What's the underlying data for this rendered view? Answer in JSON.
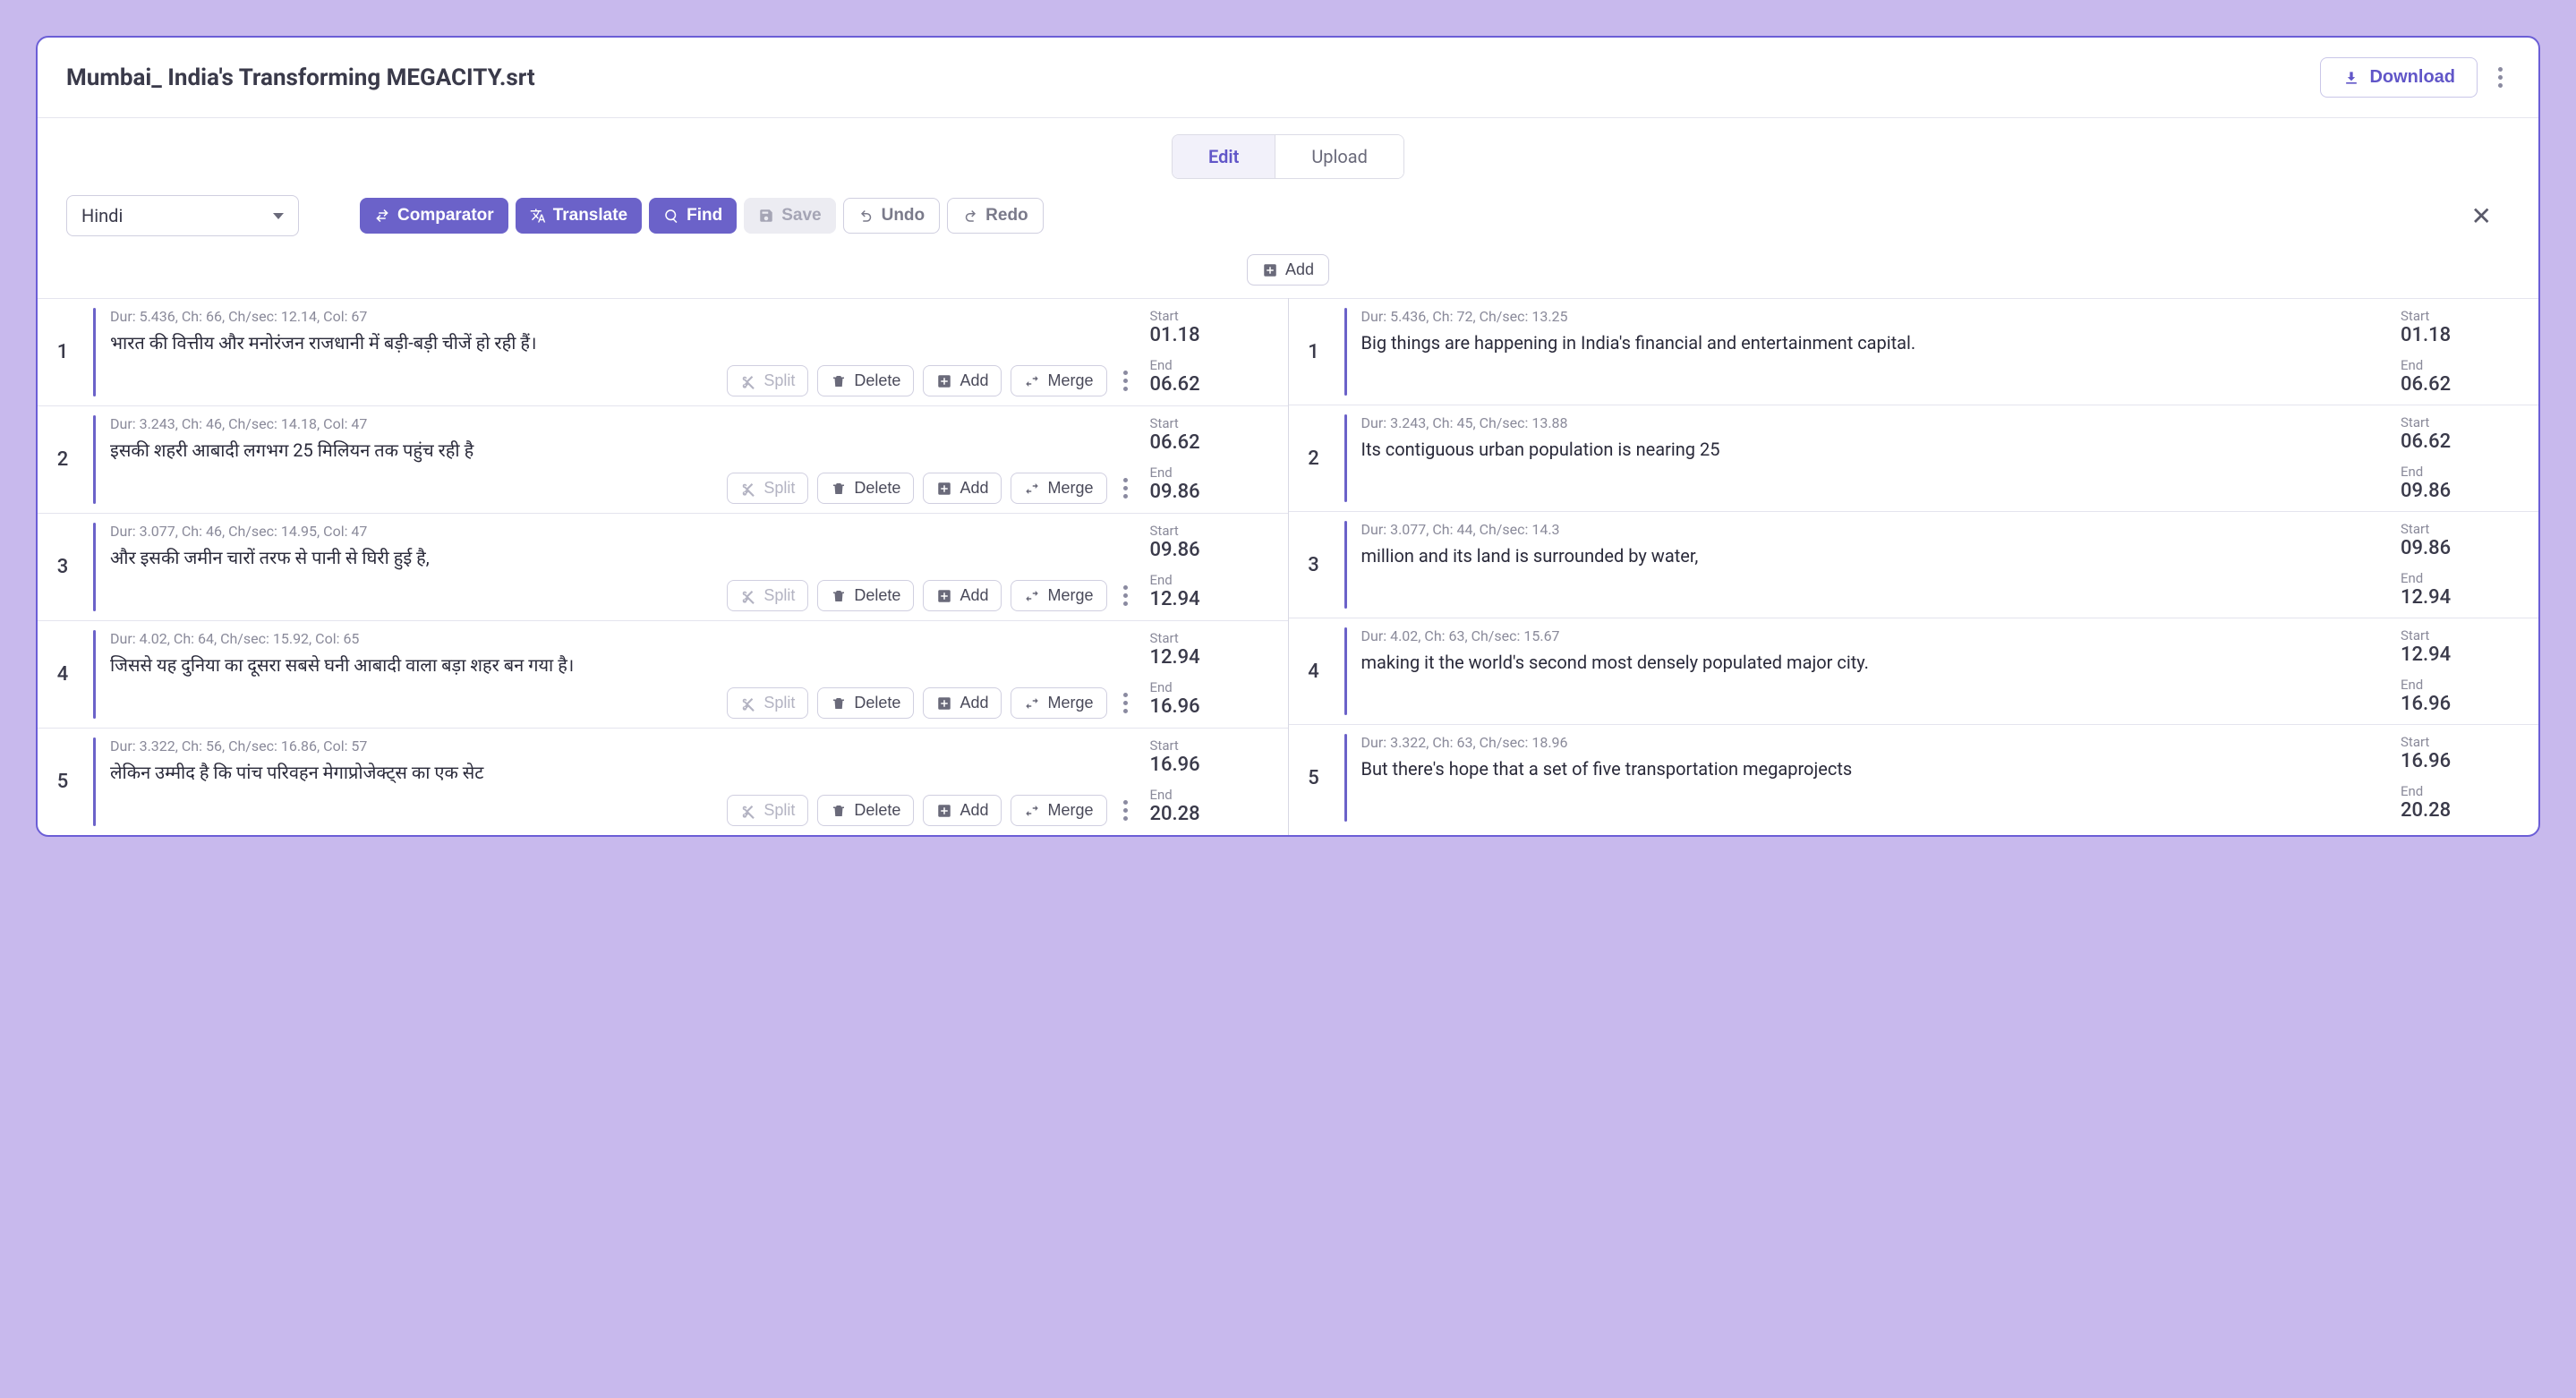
{
  "header": {
    "title": "Mumbai_ India's Transforming MEGACITY.srt",
    "download_label": "Download"
  },
  "tabs": {
    "edit": "Edit",
    "upload": "Upload"
  },
  "toolbar": {
    "language": "Hindi",
    "comparator": "Comparator",
    "translate": "Translate",
    "find": "Find",
    "save": "Save",
    "undo": "Undo",
    "redo": "Redo",
    "add_top": "Add"
  },
  "row_buttons": {
    "split": "Split",
    "delete": "Delete",
    "add": "Add",
    "merge": "Merge"
  },
  "time_labels": {
    "start": "Start",
    "end": "End"
  },
  "left_rows": [
    {
      "n": "1",
      "meta": "Dur: 5.436, Ch: 66, Ch/sec: 12.14, Col: 67",
      "text": "भारत की वित्तीय और मनोरंजन राजधानी में बड़ी-बड़ी चीजें हो रही हैं।",
      "start": "01.18",
      "end": "06.62"
    },
    {
      "n": "2",
      "meta": "Dur: 3.243, Ch: 46, Ch/sec: 14.18, Col: 47",
      "text": "इसकी शहरी आबादी लगभग 25 मिलियन तक पहुंच रही है",
      "start": "06.62",
      "end": "09.86"
    },
    {
      "n": "3",
      "meta": "Dur: 3.077, Ch: 46, Ch/sec: 14.95, Col: 47",
      "text": "और इसकी जमीन चारों तरफ से पानी से घिरी हुई है,",
      "start": "09.86",
      "end": "12.94"
    },
    {
      "n": "4",
      "meta": "Dur: 4.02, Ch: 64, Ch/sec: 15.92, Col: 65",
      "text": "जिससे यह दुनिया का दूसरा सबसे घनी आबादी वाला बड़ा शहर बन गया है।",
      "start": "12.94",
      "end": "16.96"
    },
    {
      "n": "5",
      "meta": "Dur: 3.322, Ch: 56, Ch/sec: 16.86, Col: 57",
      "text": "लेकिन उम्मीद है कि पांच परिवहन मेगाप्रोजेक्ट्स का एक सेट",
      "start": "16.96",
      "end": "20.28"
    }
  ],
  "right_rows": [
    {
      "n": "1",
      "meta": "Dur: 5.436, Ch: 72, Ch/sec: 13.25",
      "text": "Big things are happening in India's financial and entertainment capital.",
      "start": "01.18",
      "end": "06.62"
    },
    {
      "n": "2",
      "meta": "Dur: 3.243, Ch: 45, Ch/sec: 13.88",
      "text": "Its contiguous urban population is nearing 25",
      "start": "06.62",
      "end": "09.86"
    },
    {
      "n": "3",
      "meta": "Dur: 3.077, Ch: 44, Ch/sec: 14.3",
      "text": "million and its land is surrounded by water,",
      "start": "09.86",
      "end": "12.94"
    },
    {
      "n": "4",
      "meta": "Dur: 4.02, Ch: 63, Ch/sec: 15.67",
      "text": "making it the world's second most densely populated major city.",
      "start": "12.94",
      "end": "16.96"
    },
    {
      "n": "5",
      "meta": "Dur: 3.322, Ch: 63, Ch/sec: 18.96",
      "text": "But there's hope that a set of five transportation megaprojects",
      "start": "16.96",
      "end": "20.28"
    }
  ]
}
